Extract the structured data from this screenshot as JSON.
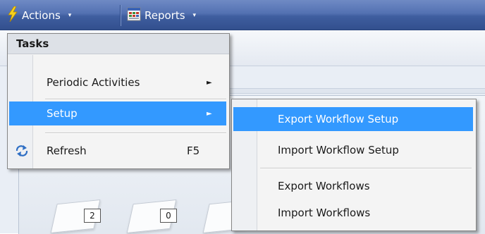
{
  "menubar": {
    "actions": {
      "label": "Actions",
      "icon": "lightning-icon",
      "caret": "▾"
    },
    "reports": {
      "label": "Reports",
      "icon": "report-icon",
      "caret": "▾"
    }
  },
  "background": {
    "badges": [
      "2",
      "0"
    ]
  },
  "actions_menu": {
    "header": "Tasks",
    "items": [
      {
        "label": "Periodic Activities",
        "arrow": "►"
      },
      {
        "label": "Setup",
        "arrow": "►",
        "selected": true
      },
      {
        "label": "Refresh",
        "shortcut": "F5",
        "icon": "refresh-icon"
      }
    ]
  },
  "setup_submenu": {
    "items": [
      {
        "label": "Export Workflow Setup",
        "selected": true
      },
      {
        "label": "Import Workflow Setup"
      },
      {
        "label": "Export Workflows"
      },
      {
        "label": "Import Workflows"
      }
    ]
  },
  "colors": {
    "menubar": "#4a68aa",
    "highlight": "#3399ff",
    "lightning": "#f7d21e"
  }
}
